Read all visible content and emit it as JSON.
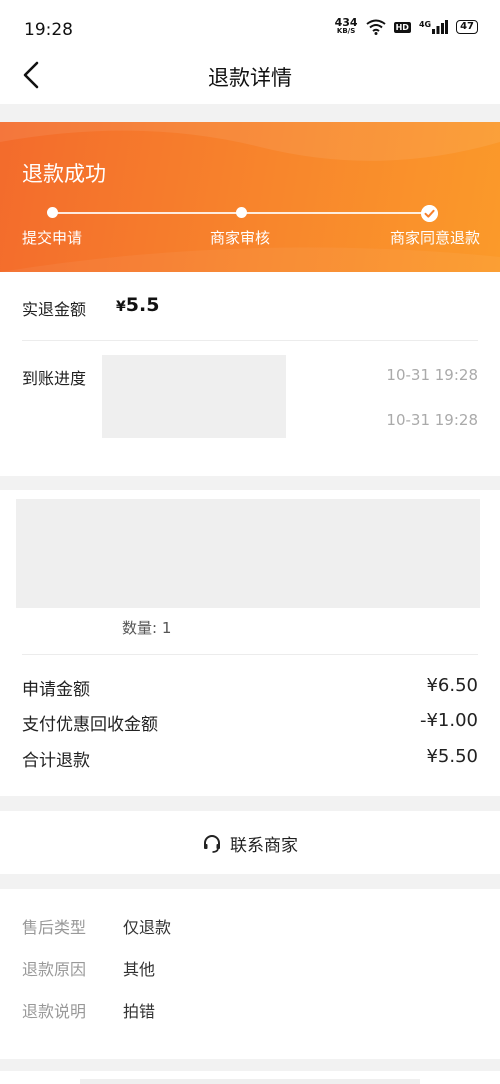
{
  "status_bar": {
    "time": "19:28",
    "speed_value": "434",
    "speed_unit": "KB/S",
    "hd": "HD",
    "network": "4G",
    "battery": "47"
  },
  "header": {
    "title": "退款详情"
  },
  "banner": {
    "status_title": "退款成功",
    "steps": [
      "提交申请",
      "商家审核",
      "商家同意退款"
    ]
  },
  "refund_summary": {
    "actual_refund_label": "实退金额",
    "currency": "¥",
    "actual_refund_value": "5.5",
    "arrival_label": "到账进度",
    "times": [
      "10-31 19:28",
      "10-31 19:28"
    ]
  },
  "product": {
    "quantity_text": "数量: 1",
    "rows": [
      {
        "label": "申请金额",
        "value": "¥6.50"
      },
      {
        "label": "支付优惠回收金额",
        "value": "-¥1.00"
      },
      {
        "label": "合计退款",
        "value": "¥5.50"
      }
    ]
  },
  "contact": {
    "label": "联系商家"
  },
  "details": [
    {
      "key": "售后类型",
      "value": "仅退款"
    },
    {
      "key": "退款原因",
      "value": "其他"
    },
    {
      "key": "退款说明",
      "value": "拍错"
    }
  ],
  "colors": {
    "accent_orange": "#f7802c",
    "page_bg": "#f2f2f2"
  }
}
